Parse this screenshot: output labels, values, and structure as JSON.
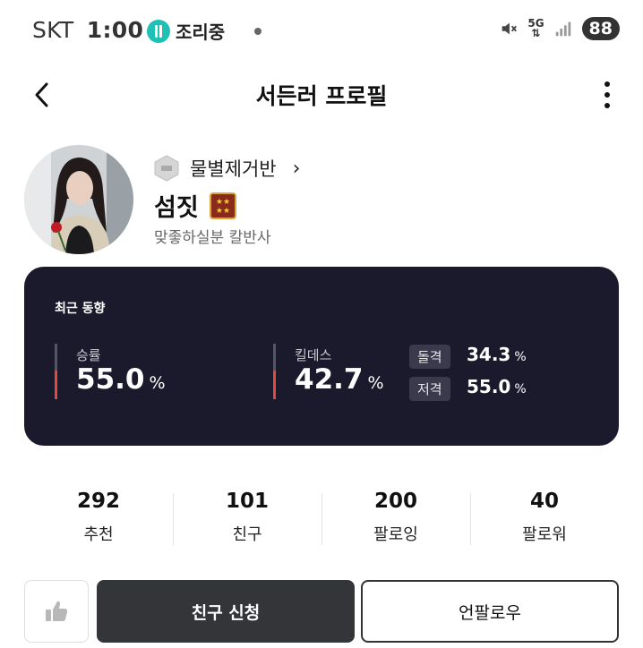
{
  "status_bar": {
    "carrier": "SKT",
    "time": "1:00",
    "app_name": "조리중",
    "network": "5G",
    "battery": "88",
    "icons": [
      "mute-icon",
      "network-5g-icon",
      "signal-icon",
      "battery-icon"
    ]
  },
  "header": {
    "title": "서든러 프로필",
    "icons": [
      "back-arrow-icon",
      "more-vertical-icon"
    ]
  },
  "profile": {
    "clan_name": "물별제거반",
    "nickname": "섬짓",
    "description": "맞좋하실분 칼반사",
    "icons": [
      "clan-emblem-icon",
      "chevron-right-icon",
      "rank-badge-icon"
    ]
  },
  "recent_trend": {
    "title": "최근 동향",
    "win_rate": {
      "label": "승률",
      "value": "55.0",
      "unit": "%"
    },
    "kill_death": {
      "label": "킬데스",
      "value": "42.7",
      "unit": "%"
    },
    "assault": {
      "label": "돌격",
      "value": "34.3",
      "unit": "%"
    },
    "sniper": {
      "label": "저격",
      "value": "55.0",
      "unit": "%"
    }
  },
  "counts": [
    {
      "value": "292",
      "label": "추천"
    },
    {
      "value": "101",
      "label": "친구"
    },
    {
      "value": "200",
      "label": "팔로잉"
    },
    {
      "value": "40",
      "label": "팔로워"
    }
  ],
  "actions": {
    "like_icon": "thumbs-up-icon",
    "friend_request": "친구 신청",
    "unfollow": "언팔로우"
  },
  "colors": {
    "card_bg": "#1b1a2c",
    "accent_bar": "#e34a3a",
    "primary_button": "#333538",
    "app_icon": "#1fc1b4"
  }
}
